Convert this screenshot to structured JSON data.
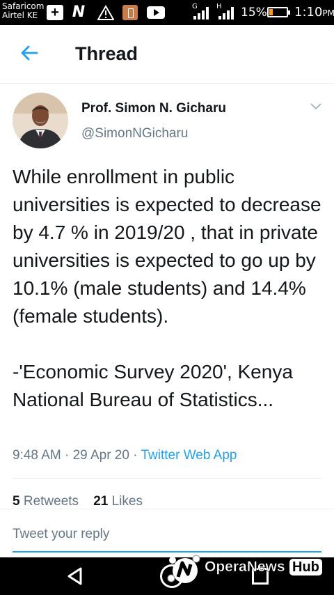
{
  "status_bar": {
    "carrier_1": "Safaricom",
    "carrier_2": "Airtel KE",
    "net_1": "G",
    "net_2": "H",
    "battery": "15%",
    "time": "1:10",
    "ampm": "PM"
  },
  "header": {
    "title": "Thread"
  },
  "tweet": {
    "name": "Prof. Simon N. Gicharu",
    "handle": "@SimonNGicharu",
    "text": "While enrollment in public universities is expected to decrease by 4.7 % in 2019/20 , that in private universities is expected to go up by 10.1% (male students) and 14.4% (female students).\n\n-'Economic Survey 2020', Kenya National Bureau of Statistics...",
    "time": "9:48 AM · 29 Apr 20 · ",
    "source": "Twitter Web App",
    "retweets_count": "5",
    "retweets_label": "Retweets",
    "likes_count": "21",
    "likes_label": "Likes"
  },
  "reply": {
    "placeholder": "Tweet your reply"
  },
  "watermark": {
    "brand": "OperaNews",
    "badge": "Hub"
  },
  "colors": {
    "accent": "#1da1f2",
    "text": "#14171a",
    "muted": "#657786"
  }
}
